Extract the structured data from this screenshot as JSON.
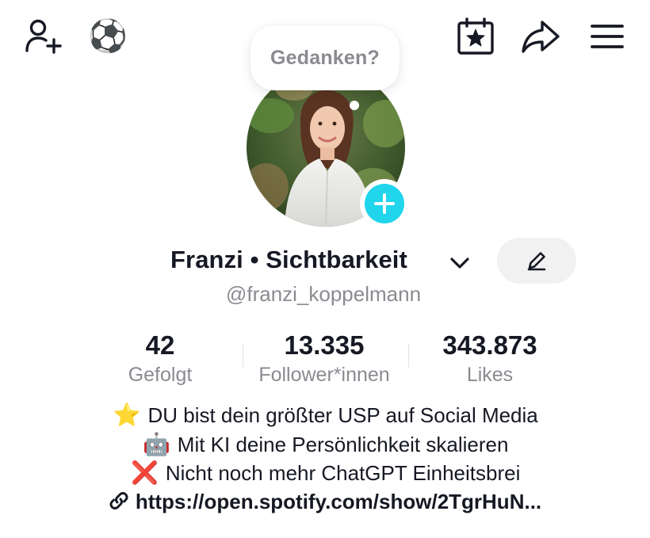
{
  "header": {
    "left_icons": [
      "add-friend-icon",
      "soccer-ball-emoji"
    ],
    "right_icons": [
      "calendar-star-icon",
      "share-icon",
      "menu-icon"
    ],
    "emoji_ball": "⚽"
  },
  "thought_bubble": {
    "text": "Gedanken?"
  },
  "profile": {
    "display_name": "Franzi • Sichtbarkeit",
    "username": "@franzi_koppelmann",
    "avatar": "profile-photo",
    "accent_color": "#20d5ec"
  },
  "stats": [
    {
      "value": "42",
      "label": "Gefolgt"
    },
    {
      "value": "13.335",
      "label": "Follower*innen"
    },
    {
      "value": "343.873",
      "label": "Likes"
    }
  ],
  "bio": {
    "lines": [
      {
        "emoji": "⭐",
        "text": "DU bist dein größter USP auf Social Media"
      },
      {
        "emoji": "🤖",
        "text": "Mit KI deine Persönlichkeit skalieren"
      },
      {
        "emoji": "❌",
        "text": "Nicht noch mehr ChatGPT Einheitsbrei"
      }
    ],
    "link": "https://open.spotify.com/show/2TgrHuN..."
  }
}
